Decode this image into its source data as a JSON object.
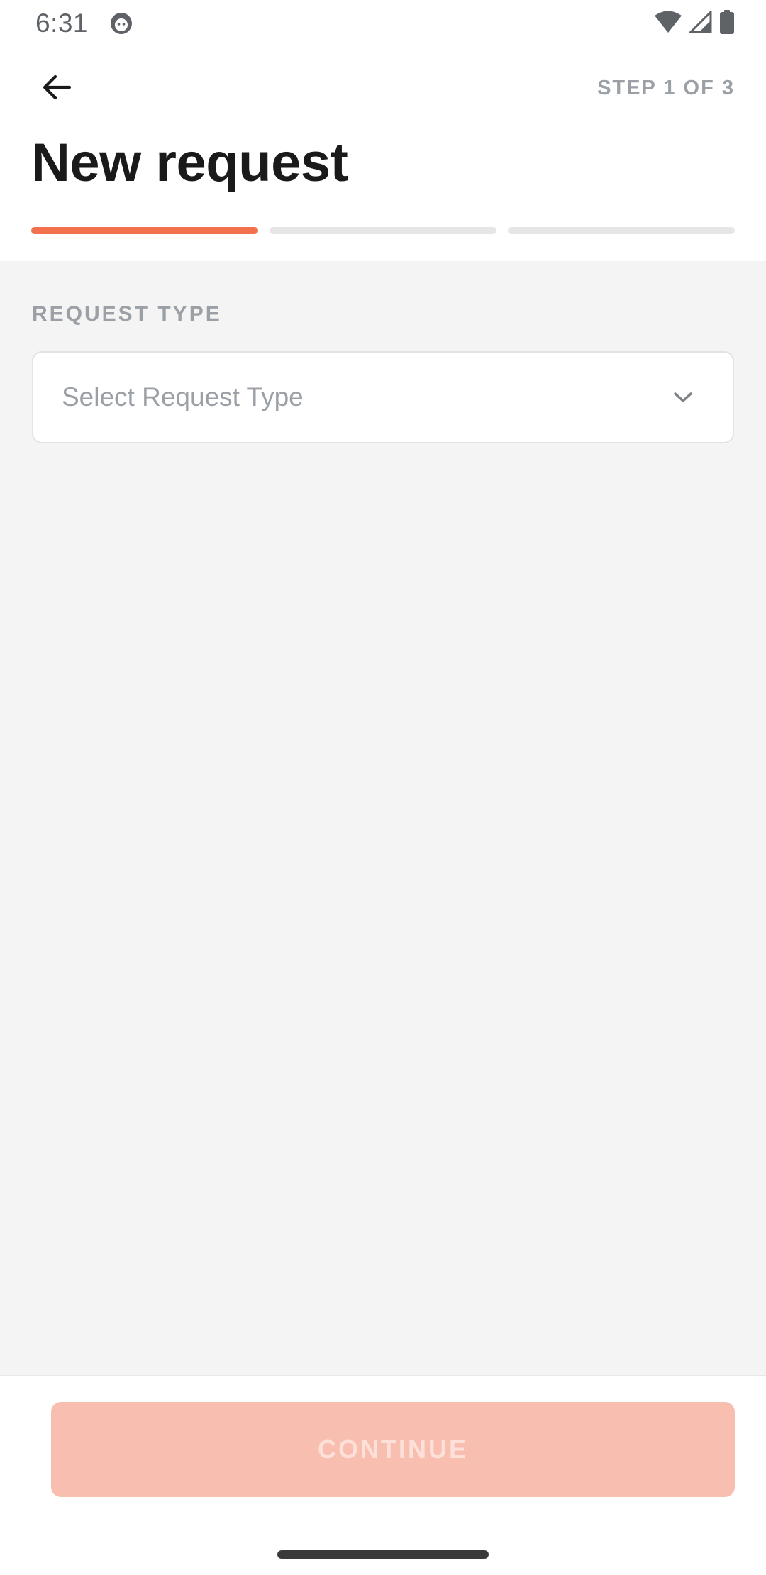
{
  "status_bar": {
    "time": "6:31",
    "icons": [
      "app-notification-icon",
      "wifi-icon",
      "cellular-signal-icon",
      "battery-icon"
    ]
  },
  "header": {
    "back_icon": "arrow-left-icon",
    "step_label": "STEP 1 OF 3",
    "title": "New request",
    "progress": {
      "total_steps": 3,
      "current_step": 1
    }
  },
  "form": {
    "request_type": {
      "label": "REQUEST TYPE",
      "placeholder": "Select Request Type",
      "chevron_icon": "chevron-down-icon"
    }
  },
  "footer": {
    "continue_label": "CONTINUE",
    "continue_enabled": false
  },
  "colors": {
    "accent": "#f3704f",
    "accent_disabled": "#f8bfb0",
    "progress_inactive": "#e6e6e6",
    "content_background": "#f4f4f4",
    "muted_text": "#9aa0a6",
    "title_text": "#1a1a1a"
  }
}
